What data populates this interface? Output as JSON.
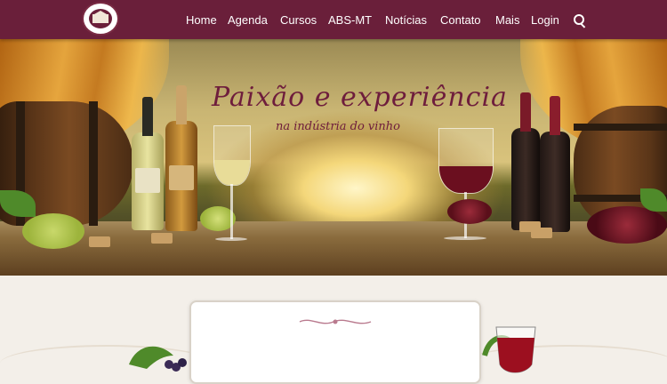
{
  "header": {
    "logo_name": "abs-mt-logo",
    "nav": [
      {
        "label": "Home"
      },
      {
        "label": "Agenda"
      },
      {
        "label": "Cursos"
      },
      {
        "label": "ABS-MT"
      },
      {
        "label": "Notícias"
      },
      {
        "label": "Contato"
      },
      {
        "label": "Mais"
      },
      {
        "label": "Login"
      }
    ],
    "search_icon": "search-icon"
  },
  "hero": {
    "title": "Paixão e experiência",
    "subtitle": "na indústria do vinho"
  },
  "colors": {
    "header_bg": "#6a1f3a",
    "accent": "#6e1d3c",
    "page_bg": "#f3efe9"
  }
}
